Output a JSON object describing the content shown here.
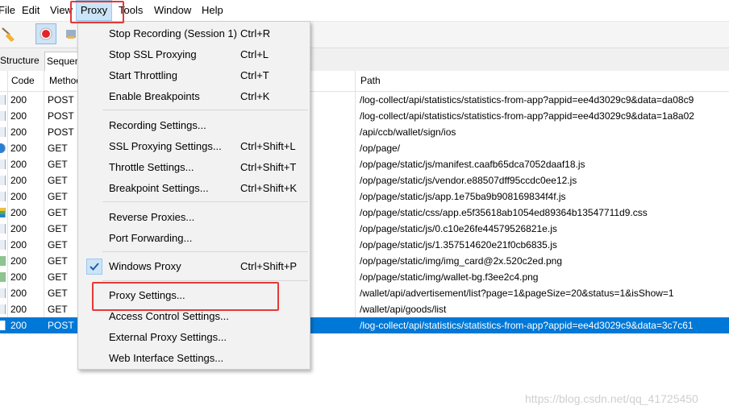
{
  "menubar": {
    "items": [
      "File",
      "Edit",
      "View",
      "Proxy",
      "Tools",
      "Window",
      "Help"
    ]
  },
  "tabs": [
    "Structure",
    "Sequence"
  ],
  "columns": {
    "code": "Code",
    "method": "Method",
    "path": "Path"
  },
  "rows": [
    {
      "code": "200",
      "method": "POST",
      "path": "/log-collect/api/statistics/statistics-from-app?appid=ee4d3029c9&data=da08c9"
    },
    {
      "code": "200",
      "method": "POST",
      "path": "/log-collect/api/statistics/statistics-from-app?appid=ee4d3029c9&data=1a8a02"
    },
    {
      "code": "200",
      "method": "POST",
      "path": "/api/ccb/wallet/sign/ios"
    },
    {
      "code": "200",
      "method": "GET",
      "path": "/op/page/"
    },
    {
      "code": "200",
      "method": "GET",
      "path": "/op/page/static/js/manifest.caafb65dca7052daaf18.js"
    },
    {
      "code": "200",
      "method": "GET",
      "path": "/op/page/static/js/vendor.e88507dff95ccdc0ee12.js"
    },
    {
      "code": "200",
      "method": "GET",
      "path": "/op/page/static/js/app.1e75ba9b908169834f4f.js"
    },
    {
      "code": "200",
      "method": "GET",
      "path": "/op/page/static/css/app.e5f35618ab1054ed89364b13547711d9.css"
    },
    {
      "code": "200",
      "method": "GET",
      "path": "/op/page/static/js/0.c10e26fe44579526821e.js"
    },
    {
      "code": "200",
      "method": "GET",
      "path": "/op/page/static/js/1.357514620e21f0cb6835.js"
    },
    {
      "code": "200",
      "method": "GET",
      "path": "/op/page/static/img/img_card@2x.520c2ed.png"
    },
    {
      "code": "200",
      "method": "GET",
      "path": "/op/page/static/img/wallet-bg.f3ee2c4.png"
    },
    {
      "code": "200",
      "method": "GET",
      "path": "/wallet/api/advertisement/list?page=1&pageSize=20&status=1&isShow=1"
    },
    {
      "code": "200",
      "method": "GET",
      "path": "/wallet/api/goods/list"
    },
    {
      "code": "200",
      "method": "POST",
      "path": "/log-collect/api/statistics/statistics-from-app?appid=ee4d3029c9&data=3c7c61"
    }
  ],
  "proxy_menu": {
    "group1": [
      {
        "label": "Stop Recording (Session 1)",
        "shortcut": "Ctrl+R"
      },
      {
        "label": "Stop SSL Proxying",
        "shortcut": "Ctrl+L"
      },
      {
        "label": "Start Throttling",
        "shortcut": "Ctrl+T"
      },
      {
        "label": "Enable Breakpoints",
        "shortcut": "Ctrl+K"
      }
    ],
    "group2": [
      {
        "label": "Recording Settings...",
        "shortcut": ""
      },
      {
        "label": "SSL Proxying Settings...",
        "shortcut": "Ctrl+Shift+L"
      },
      {
        "label": "Throttle Settings...",
        "shortcut": "Ctrl+Shift+T"
      },
      {
        "label": "Breakpoint Settings...",
        "shortcut": "Ctrl+Shift+K"
      }
    ],
    "group3": [
      {
        "label": "Reverse Proxies...",
        "shortcut": ""
      },
      {
        "label": "Port Forwarding...",
        "shortcut": ""
      }
    ],
    "windows_proxy": {
      "label": "Windows Proxy",
      "shortcut": "Ctrl+Shift+P",
      "checked": true
    },
    "group4": [
      {
        "label": "Proxy Settings...",
        "shortcut": ""
      },
      {
        "label": "Access Control Settings...",
        "shortcut": ""
      },
      {
        "label": "External Proxy Settings...",
        "shortcut": ""
      },
      {
        "label": "Web Interface Settings...",
        "shortcut": ""
      }
    ]
  },
  "watermark": "https://blog.csdn.net/qq_41725450",
  "colors": {
    "selection": "#0078d7",
    "annotation": "#e53935",
    "menu_hover": "#cce4f7"
  }
}
